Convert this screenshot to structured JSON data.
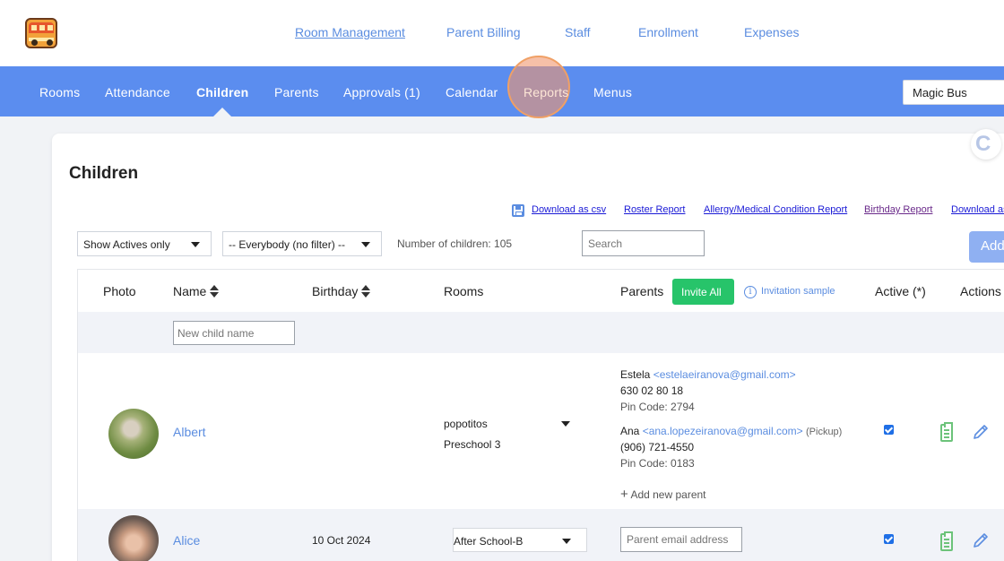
{
  "top_nav": {
    "items": [
      "Room Management",
      "Parent Billing",
      "Staff",
      "Enrollment",
      "Expenses"
    ]
  },
  "main_nav": {
    "items": [
      "Rooms",
      "Attendance",
      "Children",
      "Parents",
      "Approvals (1)",
      "Calendar",
      "Reports",
      "Menus"
    ],
    "active": "Children",
    "school": "Magic Bus"
  },
  "page": {
    "title": "Children",
    "report_links": [
      "Download as csv",
      "Roster Report",
      "Allergy/Medical Condition Report",
      "Birthday Report",
      "Download as"
    ],
    "status_filter": "Show Actives only",
    "group_filter": "-- Everybody (no filter) --",
    "children_count": "Number of children: 105",
    "search_placeholder": "Search",
    "add_label": "Add"
  },
  "table": {
    "headers": {
      "photo": "Photo",
      "name": "Name",
      "birthday": "Birthday",
      "rooms": "Rooms",
      "parents": "Parents",
      "invite_all": "Invite All",
      "invitation_sample": "Invitation sample",
      "active": "Active (*)",
      "actions": "Actions"
    },
    "new_child_placeholder": "New child name",
    "rows": [
      {
        "name": "Albert",
        "birthday": "",
        "rooms": [
          "popotitos",
          "Preschool 3"
        ],
        "parents": [
          {
            "name": "Estela",
            "email": "<estelaeiranova@gmail.com>",
            "note": "",
            "phone": "630 02 80 18",
            "pin": "Pin Code: 2794"
          },
          {
            "name": "Ana",
            "email": "<ana.lopezeiranova@gmail.com>",
            "note": "(Pickup)",
            "phone": "(906) 721-4550",
            "pin": "Pin Code: 0183"
          }
        ],
        "add_parent": "Add new parent",
        "active": true
      },
      {
        "name": "Alice",
        "birthday": "10 Oct 2024",
        "room": "After School-B",
        "parent_email_placeholder": "Parent email address",
        "active": true
      }
    ]
  },
  "colors": {
    "nav_blue": "#5b8def",
    "link_blue": "#5b8de0",
    "invite_green": "#27c46a",
    "highlight": "#f0a065"
  },
  "icons": [
    "bus-logo-icon",
    "chevron-down-icon",
    "save-disk-icon",
    "sort-icon",
    "info-icon",
    "clipboard-icon",
    "pencil-icon",
    "plus-icon"
  ]
}
